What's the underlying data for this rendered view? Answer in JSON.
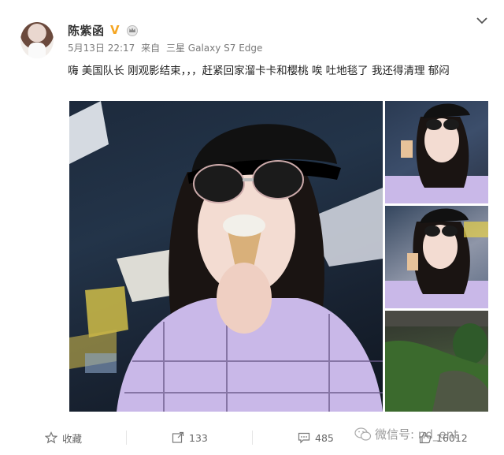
{
  "post": {
    "username": "陈紫函",
    "verify_icon": "V",
    "date": "5月13日 22:17",
    "source_prefix": "来自",
    "device": "三星 Galaxy S7 Edge",
    "text": "嗨 美国队长 刚观影结束，，，赶紧回家溜卡卡和樱桃 唉 吐地毯了 我还得清理 郁闷"
  },
  "actions": {
    "favorite_label": "收藏",
    "repost_count": "133",
    "comment_count": "485",
    "like_count": "16012"
  },
  "watermark": "微信号: nd_ent",
  "icons": [
    "chevron-down-icon",
    "verified-badge-icon",
    "crown-icon",
    "star-icon",
    "repost-icon",
    "comment-icon",
    "like-icon",
    "wechat-icon"
  ],
  "colors": {
    "verify": "#f5a623",
    "text": "#222222",
    "meta": "#7a7a7a"
  }
}
